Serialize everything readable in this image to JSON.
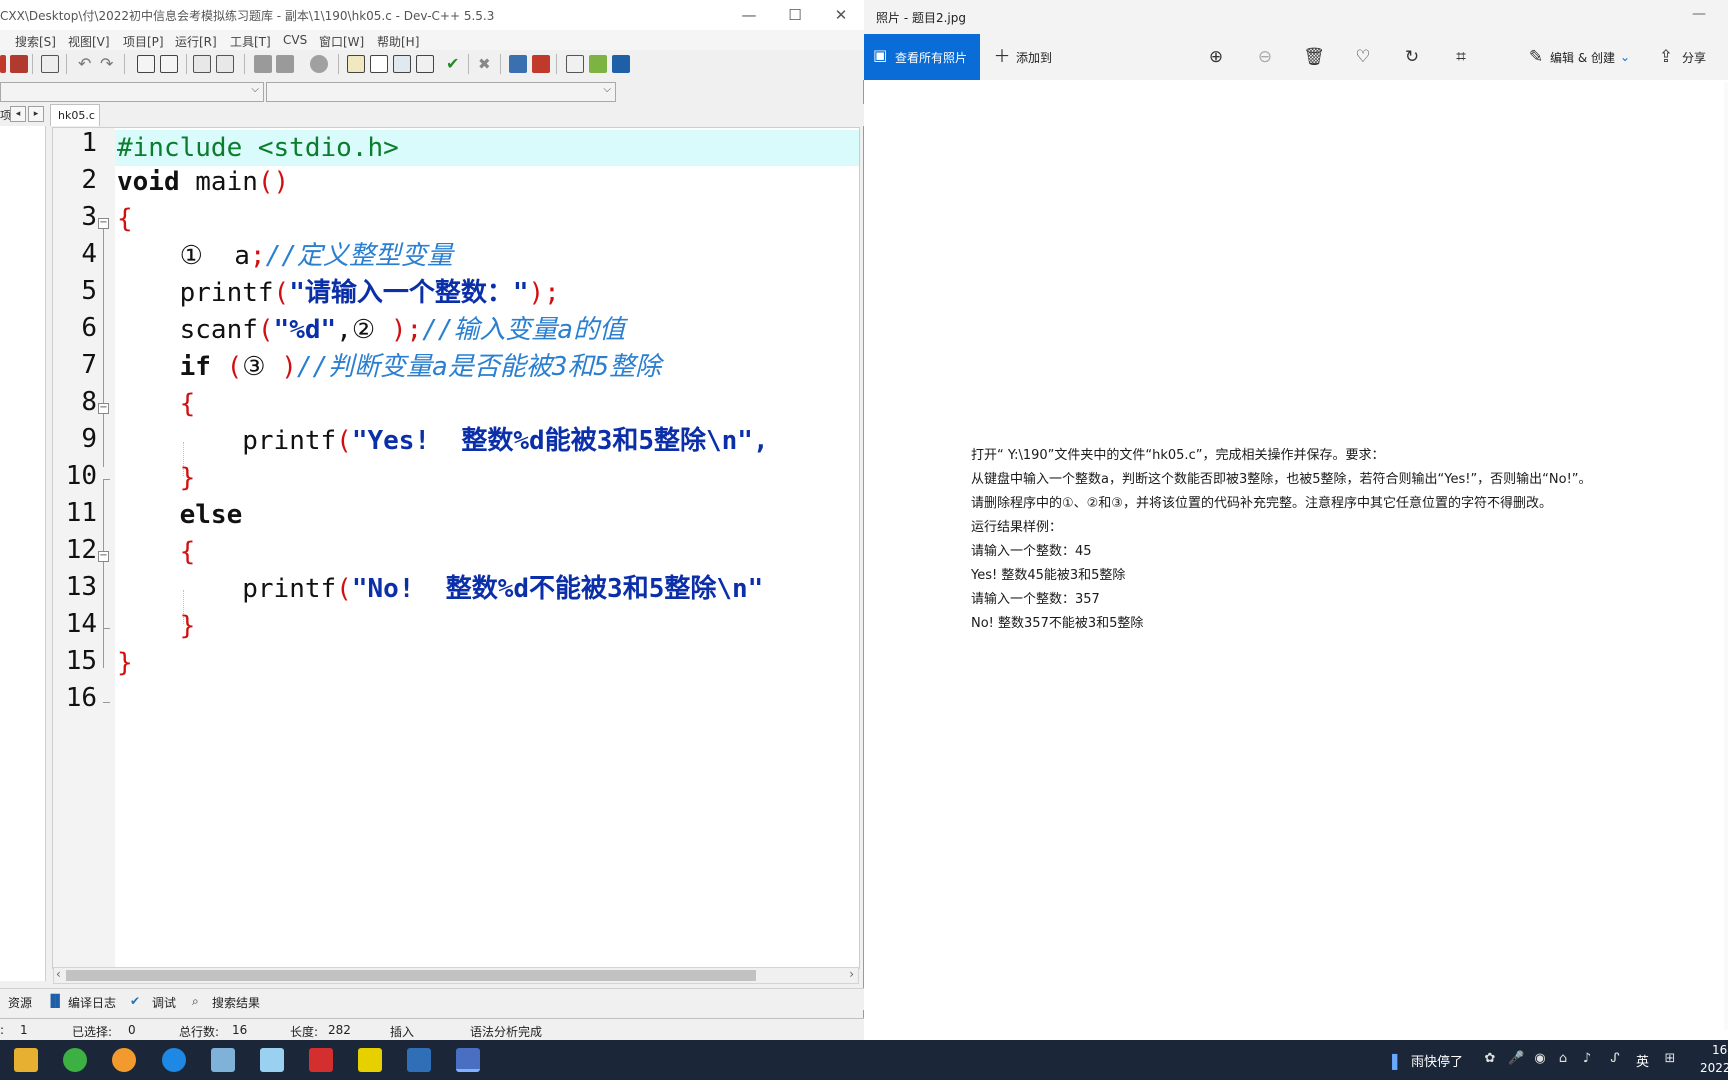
{
  "devcpp": {
    "title": "CXX\\Desktop\\付\\2022初中信息会考模拟练习题库 - 副本\\1\\190\\hk05.c - Dev-C++ 5.5.3",
    "menu": [
      "搜索[S]",
      "视图[V]",
      "项目[P]",
      "运行[R]",
      "工具[T]",
      "CVS",
      "窗口[W]",
      "帮助[H]"
    ],
    "left_tab_fragment": "项",
    "file_tab": "hk05.c",
    "code": {
      "line_numbers": [
        "1",
        "2",
        "3",
        "4",
        "5",
        "6",
        "7",
        "8",
        "9",
        "10",
        "11",
        "12",
        "13",
        "14",
        "15",
        "16"
      ],
      "l1": "#include <stdio.h>",
      "l2_kw": "void",
      "l2_rest": " main",
      "paren_pair": "()",
      "brace_open": "{",
      "brace_close": "}",
      "l4_marker": "①",
      "l4_var": "  a",
      "semicolon": ";",
      "l4_comment": "//定义整型变量",
      "l5_fn": "printf",
      "open_paren": "(",
      "l5_str": "\"请输入一个整数：\"",
      "close_semi": ");",
      "l6_fn": "scanf",
      "l6_str": "\"%d\"",
      "l6_mid": ",② ",
      "l6_comment": "//输入变量a的值",
      "l7_kw": "if",
      "l7_mid": "③ ",
      "close_paren": ")",
      "l7_comment": "//判断变量a是否能被3和5整除",
      "l9_str": "\"Yes!  整数%d能被3和5整除\\n\",",
      "l11_kw": "else",
      "l13_str": "\"No!  整数%d不能被3和5整除\\n\""
    },
    "bottom_tabs": [
      "资源",
      "编译日志",
      "调试",
      "搜索结果"
    ],
    "status": {
      "line_value": "1",
      "selected_label": "已选择:",
      "selected_value": "0",
      "total_label": "总行数:",
      "total_value": "16",
      "length_label": "长度:",
      "length_value": "282",
      "mode": "插入",
      "parse": "语法分析完成"
    }
  },
  "photos": {
    "title": "照片 - 题目2.jpg",
    "view_all": "查看所有照片",
    "add_to": "添加到",
    "edit_create": "编辑 & 创建",
    "share": "分享",
    "doc_lines": [
      "打开“ Y:\\190”文件夹中的文件“hk05.c”，完成相关操作并保存。要求：",
      "从键盘中输入一个整数a，判断这个数能否即被3整除，也被5整除，若符合则输出“Yes!”，否则输出“No!”。",
      "请删除程序中的①、②和③，并将该位置的代码补充完整。注意程序中其它任意位置的字符不得删改。",
      "运行结果样例：",
      "请输入一个整数：45",
      "Yes!  整数45能被3和5整除",
      "请输入一个整数：357",
      "No!  整数357不能被3和5整除"
    ]
  },
  "taskbar": {
    "weather": "雨快停了",
    "ime": "英",
    "time_fragment": "16",
    "date_fragment": "2022"
  },
  "colors": {
    "accent_blue": "#0a6cd6",
    "taskbar_bg": "#1b2738",
    "current_line": "#d9fbfb",
    "preprocessor": "#0b7d2c",
    "string": "#0a2fa8",
    "comment": "#2a7fd0",
    "bracket": "#d01010"
  }
}
